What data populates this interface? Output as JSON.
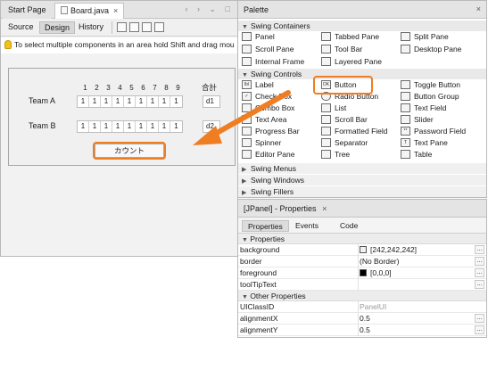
{
  "editor": {
    "tabs": [
      {
        "label": "Start Page"
      },
      {
        "label": "Board.java",
        "close": "×"
      }
    ],
    "nav_arrows": "‹ › ⌄ □",
    "toolbar": {
      "source": "Source",
      "design": "Design",
      "history": "History"
    },
    "hint": "To select multiple components in an area hold Shift and drag mou",
    "form": {
      "column_numbers": [
        "1",
        "2",
        "3",
        "4",
        "5",
        "6",
        "7",
        "8",
        "9"
      ],
      "total_header": "合計",
      "teams": [
        {
          "label": "Team A",
          "scores": [
            "1",
            "1",
            "1",
            "1",
            "1",
            "1",
            "1",
            "1",
            "1"
          ],
          "total": "d1"
        },
        {
          "label": "Team B",
          "scores": [
            "1",
            "1",
            "1",
            "1",
            "1",
            "1",
            "1",
            "1",
            "1"
          ],
          "total": "d2"
        }
      ],
      "count_button": "カウント"
    }
  },
  "palette": {
    "title": "Palette",
    "close": "×",
    "sections": {
      "containers": "Swing Containers",
      "controls": "Swing Controls",
      "menus": "Swing Menus",
      "windows": "Swing Windows",
      "fillers": "Swing Fillers"
    },
    "containers": [
      [
        "Panel",
        "Tabbed Pane",
        "Split Pane"
      ],
      [
        "Scroll Pane",
        "Tool Bar",
        "Desktop Pane"
      ],
      [
        "Internal Frame",
        "Layered Pane",
        ""
      ]
    ],
    "controls": [
      [
        "Label",
        "Button",
        "Toggle Button"
      ],
      [
        "Check Box",
        "Radio Button",
        "Button Group"
      ],
      [
        "Combo Box",
        "List",
        "Text Field"
      ],
      [
        "Text Area",
        "Scroll Bar",
        "Slider"
      ],
      [
        "Progress Bar",
        "Formatted Field",
        "Password Field"
      ],
      [
        "Spinner",
        "Separator",
        "Text Pane"
      ],
      [
        "Editor Pane",
        "Tree",
        "Table"
      ]
    ]
  },
  "properties": {
    "title": "[JPanel] - Properties",
    "close": "×",
    "tabs": [
      "Properties",
      "Events",
      "Code"
    ],
    "section_properties": "Properties",
    "section_other": "Other Properties",
    "rows": [
      {
        "name": "background",
        "value": "[242,242,242]"
      },
      {
        "name": "border",
        "value": "(No Border)"
      },
      {
        "name": "foreground",
        "value": "[0,0,0]"
      },
      {
        "name": "toolTipText",
        "value": ""
      }
    ],
    "other_rows": [
      {
        "name": "UIClassID",
        "value": "PanelUI"
      },
      {
        "name": "alignmentX",
        "value": "0.5"
      },
      {
        "name": "alignmentY",
        "value": "0.5"
      }
    ],
    "colors": {
      "background_swatch": "#f2f2f2",
      "foreground_swatch": "#000000"
    }
  },
  "highlight_color": "#ef7d22"
}
